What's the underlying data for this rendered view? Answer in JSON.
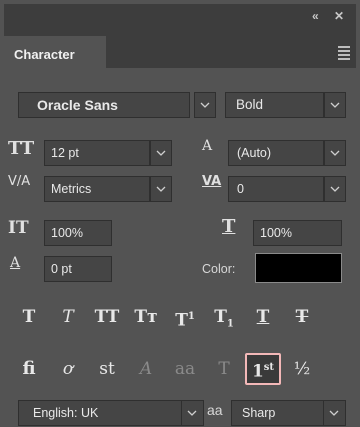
{
  "topbar": {
    "collapse_icon": "double-chevron-left-icon",
    "close_icon": "close-icon",
    "collapse_glyph": "«",
    "close_glyph": "✕"
  },
  "panel": {
    "tab_title": "Character",
    "menu_icon": "hamburger-menu-icon"
  },
  "font": {
    "family": "Oracle Sans",
    "style": "Bold"
  },
  "metrics": {
    "size": "12 pt",
    "leading": "(Auto)",
    "kerning": "Metrics",
    "tracking": "0",
    "vscale": "100%",
    "hscale": "100%",
    "baseline_shift": "0 pt",
    "color_label": "Color:"
  },
  "glyphs": {
    "size_icon": "TT",
    "leading_icon": "A",
    "kern_icon": "V/A",
    "track_icon": "VA",
    "vscale_icon": "IT",
    "hscale_icon": "T",
    "baseline_icon": "A"
  },
  "colors": {
    "text_color": "#000000",
    "highlight_border": "#f3b8b8"
  },
  "style_buttons": [
    {
      "label": "T"
    },
    {
      "label": "T"
    },
    {
      "label": "TT"
    },
    {
      "label": "Tт"
    },
    {
      "label": "T"
    },
    {
      "label": "T"
    },
    {
      "label": "T"
    },
    {
      "label": "T"
    }
  ],
  "opentype_buttons": [
    {
      "label": "fi"
    },
    {
      "label": "ơ"
    },
    {
      "label": "st"
    },
    {
      "label": "A"
    },
    {
      "label": "aa"
    },
    {
      "label": "T"
    },
    {
      "label": "1",
      "sup": "st"
    },
    {
      "label": "½"
    }
  ],
  "bottom": {
    "language": "English: UK",
    "aa_icon": "aa",
    "antialias": "Sharp"
  }
}
